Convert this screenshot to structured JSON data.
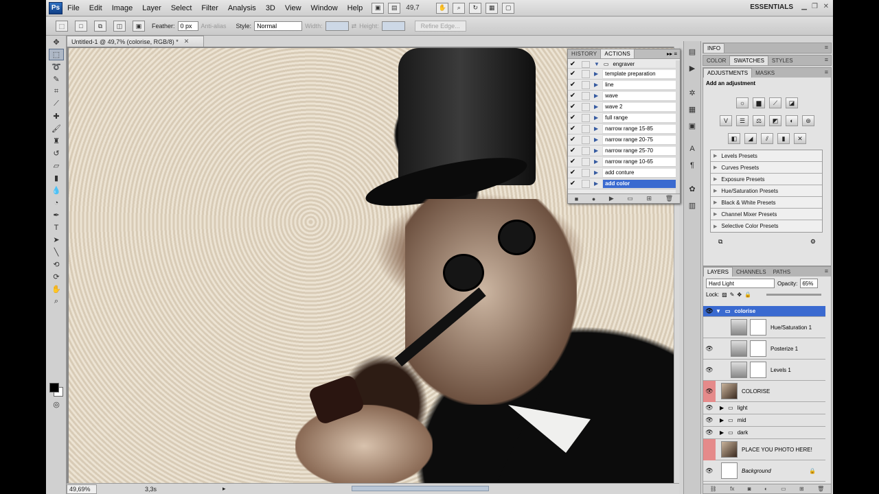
{
  "app": {
    "logo": "Ps",
    "menu": [
      "File",
      "Edit",
      "Image",
      "Layer",
      "Select",
      "Filter",
      "Analysis",
      "3D",
      "View",
      "Window",
      "Help"
    ],
    "zoom_field": "49,7",
    "workspace": "ESSENTIALS"
  },
  "options": {
    "feather_label": "Feather:",
    "feather_value": "0 px",
    "antialias_label": "Anti-alias",
    "style_label": "Style:",
    "style_value": "Normal",
    "width_label": "Width:",
    "height_label": "Height:",
    "refine_edge": "Refine Edge..."
  },
  "document": {
    "tab_title": "Untitled-1 @ 49,7% (colorise, RGB/8) *",
    "status_zoom": "49,69%",
    "status_info": "3,3s"
  },
  "actions_panel": {
    "tabs": [
      "HISTORY",
      "ACTIONS"
    ],
    "set_name": "engraver",
    "items": [
      {
        "label": "template preparation",
        "selected": false
      },
      {
        "label": "line",
        "selected": false
      },
      {
        "label": "wave",
        "selected": false
      },
      {
        "label": "wave 2",
        "selected": false
      },
      {
        "label": "full range",
        "selected": false
      },
      {
        "label": "narrow range 15-85",
        "selected": false
      },
      {
        "label": "narrow range 20-75",
        "selected": false
      },
      {
        "label": "narrow range 25-70",
        "selected": false
      },
      {
        "label": "narrow range 10-65",
        "selected": false
      },
      {
        "label": "add conture",
        "selected": false
      },
      {
        "label": "add color",
        "selected": true
      }
    ]
  },
  "info_panel": {
    "tab": "INFO"
  },
  "color_panel": {
    "tabs": [
      "COLOR",
      "SWATCHES",
      "STYLES"
    ]
  },
  "adjustments_panel": {
    "tabs": [
      "ADJUSTMENTS",
      "MASKS"
    ],
    "title": "Add an adjustment",
    "presets": [
      "Levels Presets",
      "Curves Presets",
      "Exposure Presets",
      "Hue/Saturation Presets",
      "Black & White Presets",
      "Channel Mixer Presets",
      "Selective Color Presets"
    ]
  },
  "layers_panel": {
    "tabs": [
      "LAYERS",
      "CHANNELS",
      "PATHS"
    ],
    "blend_mode": "Hard Light",
    "opacity_label": "Opacity:",
    "opacity_value": "65%",
    "lock_label": "Lock:",
    "layers": [
      {
        "name": "colorise",
        "kind": "group-selected"
      },
      {
        "name": "Hue/Saturation 1",
        "kind": "adjustment"
      },
      {
        "name": "Posterize 1",
        "kind": "adjustment"
      },
      {
        "name": "Levels 1",
        "kind": "adjustment"
      },
      {
        "name": "COLORISE",
        "kind": "photo"
      },
      {
        "name": "light",
        "kind": "group"
      },
      {
        "name": "mid",
        "kind": "group"
      },
      {
        "name": "dark",
        "kind": "group"
      },
      {
        "name": "PLACE YOU PHOTO HERE!",
        "kind": "photo"
      },
      {
        "name": "Background",
        "kind": "background"
      }
    ]
  },
  "colors": {
    "selection": "#3a6ad0",
    "chrome": "#d4d4d4"
  }
}
